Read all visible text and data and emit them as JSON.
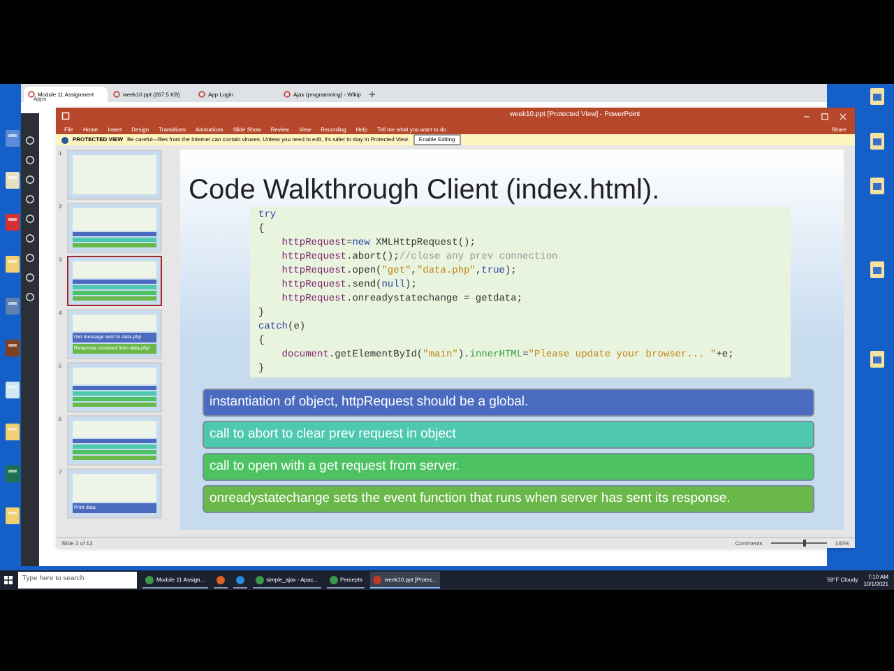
{
  "browser": {
    "tabs": [
      {
        "label": "Module 11 Assignment",
        "selected": true
      },
      {
        "label": "week10.ppt (267.5 KB)",
        "selected": false
      },
      {
        "label": "App Login",
        "selected": false
      },
      {
        "label": "Ajax (programming) - Wikip",
        "selected": false
      }
    ],
    "apps_label": "Apps"
  },
  "powerpoint": {
    "title": "week10.ppt [Protected View] - PowerPoint",
    "ribbon_tabs": [
      "File",
      "Home",
      "Insert",
      "Design",
      "Transitions",
      "Animations",
      "Slide Show",
      "Review",
      "View",
      "Recording",
      "Help"
    ],
    "tell_me": "Tell me what you want to do",
    "share": "Share",
    "protected_view": {
      "label": "PROTECTED VIEW",
      "message": "Be careful—files from the Internet can contain viruses. Unless you need to edit, it's safer to stay in Protected View.",
      "button": "Enable Editing"
    },
    "thumbnails": [
      {
        "number": "1",
        "selected": false
      },
      {
        "number": "2",
        "selected": false,
        "bars": [
          {
            "color": "#4a6bc0"
          },
          {
            "color": "#4ec9b0"
          },
          {
            "color": "#6ab84a"
          }
        ]
      },
      {
        "number": "3",
        "selected": true,
        "bars": [
          {
            "color": "#4a6bc0"
          },
          {
            "color": "#4ec9b0"
          },
          {
            "color": "#4cc262"
          },
          {
            "color": "#6ab84a"
          }
        ]
      },
      {
        "number": "4",
        "selected": false,
        "bars": [
          {
            "color": "#4a6bc0",
            "label": "Get message sent to data.php"
          },
          {
            "color": "#6ab84a",
            "label": "Response received from data.php"
          }
        ]
      },
      {
        "number": "5",
        "selected": false,
        "bars": [
          {
            "color": "#4a6bc0"
          },
          {
            "color": "#4ec9b0"
          },
          {
            "color": "#4cc262"
          },
          {
            "color": "#6ab84a"
          }
        ]
      },
      {
        "number": "6",
        "selected": false,
        "bars": [
          {
            "color": "#4a6bc0"
          },
          {
            "color": "#4ec9b0"
          },
          {
            "color": "#4cc262"
          },
          {
            "color": "#6ab84a"
          }
        ]
      },
      {
        "number": "7",
        "selected": false,
        "bars": [
          {
            "color": "#4a6bc0",
            "label": "Print data."
          }
        ]
      }
    ],
    "slide": {
      "title": "Code Walkthrough Client (index.html).",
      "code": [
        [
          {
            "text": "try",
            "kind": "keyword"
          }
        ],
        [
          {
            "text": "{",
            "kind": "plain"
          }
        ],
        [
          {
            "text": "    httpRequest",
            "kind": "object"
          },
          {
            "text": "=",
            "kind": "plain"
          },
          {
            "text": "new",
            "kind": "keyword"
          },
          {
            "text": " XMLHttpRequest();",
            "kind": "plain"
          }
        ],
        [
          {
            "text": "    httpRequest",
            "kind": "object"
          },
          {
            "text": ".abort();",
            "kind": "plain"
          },
          {
            "text": "//close any prev connection",
            "kind": "comment"
          }
        ],
        [
          {
            "text": "    httpRequest",
            "kind": "object"
          },
          {
            "text": ".open(",
            "kind": "plain"
          },
          {
            "text": "\"get\"",
            "kind": "string"
          },
          {
            "text": ",",
            "kind": "plain"
          },
          {
            "text": "\"data.php\"",
            "kind": "string"
          },
          {
            "text": ",",
            "kind": "plain"
          },
          {
            "text": "true",
            "kind": "keyword"
          },
          {
            "text": ");",
            "kind": "plain"
          }
        ],
        [
          {
            "text": "    httpRequest",
            "kind": "object"
          },
          {
            "text": ".send(",
            "kind": "plain"
          },
          {
            "text": "null",
            "kind": "keyword"
          },
          {
            "text": ");",
            "kind": "plain"
          }
        ],
        [
          {
            "text": "    httpRequest",
            "kind": "object"
          },
          {
            "text": ".onreadystatechange = getdata;",
            "kind": "plain"
          }
        ],
        [
          {
            "text": "}",
            "kind": "plain"
          }
        ],
        [
          {
            "text": "catch",
            "kind": "keyword"
          },
          {
            "text": "(e)",
            "kind": "plain"
          }
        ],
        [
          {
            "text": "{",
            "kind": "plain"
          }
        ],
        [
          {
            "text": "    document",
            "kind": "object"
          },
          {
            "text": ".getElementById(",
            "kind": "plain"
          },
          {
            "text": "\"main\"",
            "kind": "string"
          },
          {
            "text": ").",
            "kind": "plain"
          },
          {
            "text": "innerHTML",
            "kind": "member"
          },
          {
            "text": "=",
            "kind": "plain"
          },
          {
            "text": "\"Please update your browser... \"",
            "kind": "string"
          },
          {
            "text": "+e;",
            "kind": "plain"
          }
        ],
        [
          {
            "text": "}",
            "kind": "plain"
          }
        ]
      ],
      "bullets": [
        {
          "text": "instantiation of object, httpRequest should be a global.",
          "color": "#4a6bc0"
        },
        {
          "text": "call to abort to clear prev request in object",
          "color": "#4ec9b0"
        },
        {
          "text": "call to open with a get request from server.",
          "color": "#4cc262"
        },
        {
          "text": "onreadystatechange sets the event function that runs when server has sent its response.",
          "color": "#6ab84a"
        }
      ]
    },
    "status": {
      "slide_count": "Slide 3 of 13",
      "comments": "Comments",
      "zoom": "145%",
      "zoom_slider": {
        "level": 0.6
      }
    }
  },
  "taskbar": {
    "search_placeholder": "Type here to search",
    "apps": [
      {
        "label": "Module 11 Assign...",
        "kind": "chrome",
        "selected": false
      },
      {
        "kind": "firefox",
        "selected": false
      },
      {
        "kind": "edge",
        "selected": false
      },
      {
        "label": "simple_ajax - Apac...",
        "kind": "chrome",
        "selected": false
      },
      {
        "label": "Percepts",
        "kind": "chrome",
        "selected": false
      },
      {
        "label": "week10.ppt [Protec...",
        "kind": "powerpoint",
        "selected": true
      }
    ],
    "weather": "59°F  Cloudy",
    "time": "7:10 AM",
    "date": "10/1/2021"
  }
}
